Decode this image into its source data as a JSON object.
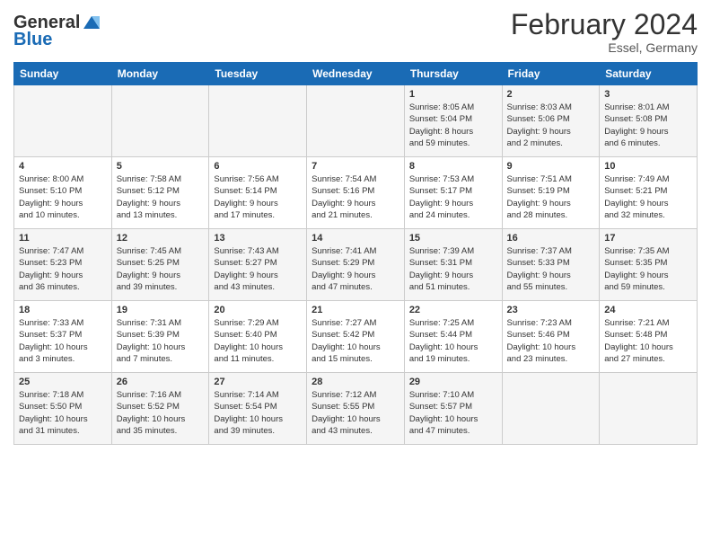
{
  "header": {
    "logo": {
      "general": "General",
      "blue": "Blue"
    },
    "title": "February 2024",
    "location": "Essel, Germany"
  },
  "days_of_week": [
    "Sunday",
    "Monday",
    "Tuesday",
    "Wednesday",
    "Thursday",
    "Friday",
    "Saturday"
  ],
  "weeks": [
    [
      {
        "day": "",
        "info": ""
      },
      {
        "day": "",
        "info": ""
      },
      {
        "day": "",
        "info": ""
      },
      {
        "day": "",
        "info": ""
      },
      {
        "day": "1",
        "info": "Sunrise: 8:05 AM\nSunset: 5:04 PM\nDaylight: 8 hours\nand 59 minutes."
      },
      {
        "day": "2",
        "info": "Sunrise: 8:03 AM\nSunset: 5:06 PM\nDaylight: 9 hours\nand 2 minutes."
      },
      {
        "day": "3",
        "info": "Sunrise: 8:01 AM\nSunset: 5:08 PM\nDaylight: 9 hours\nand 6 minutes."
      }
    ],
    [
      {
        "day": "4",
        "info": "Sunrise: 8:00 AM\nSunset: 5:10 PM\nDaylight: 9 hours\nand 10 minutes."
      },
      {
        "day": "5",
        "info": "Sunrise: 7:58 AM\nSunset: 5:12 PM\nDaylight: 9 hours\nand 13 minutes."
      },
      {
        "day": "6",
        "info": "Sunrise: 7:56 AM\nSunset: 5:14 PM\nDaylight: 9 hours\nand 17 minutes."
      },
      {
        "day": "7",
        "info": "Sunrise: 7:54 AM\nSunset: 5:16 PM\nDaylight: 9 hours\nand 21 minutes."
      },
      {
        "day": "8",
        "info": "Sunrise: 7:53 AM\nSunset: 5:17 PM\nDaylight: 9 hours\nand 24 minutes."
      },
      {
        "day": "9",
        "info": "Sunrise: 7:51 AM\nSunset: 5:19 PM\nDaylight: 9 hours\nand 28 minutes."
      },
      {
        "day": "10",
        "info": "Sunrise: 7:49 AM\nSunset: 5:21 PM\nDaylight: 9 hours\nand 32 minutes."
      }
    ],
    [
      {
        "day": "11",
        "info": "Sunrise: 7:47 AM\nSunset: 5:23 PM\nDaylight: 9 hours\nand 36 minutes."
      },
      {
        "day": "12",
        "info": "Sunrise: 7:45 AM\nSunset: 5:25 PM\nDaylight: 9 hours\nand 39 minutes."
      },
      {
        "day": "13",
        "info": "Sunrise: 7:43 AM\nSunset: 5:27 PM\nDaylight: 9 hours\nand 43 minutes."
      },
      {
        "day": "14",
        "info": "Sunrise: 7:41 AM\nSunset: 5:29 PM\nDaylight: 9 hours\nand 47 minutes."
      },
      {
        "day": "15",
        "info": "Sunrise: 7:39 AM\nSunset: 5:31 PM\nDaylight: 9 hours\nand 51 minutes."
      },
      {
        "day": "16",
        "info": "Sunrise: 7:37 AM\nSunset: 5:33 PM\nDaylight: 9 hours\nand 55 minutes."
      },
      {
        "day": "17",
        "info": "Sunrise: 7:35 AM\nSunset: 5:35 PM\nDaylight: 9 hours\nand 59 minutes."
      }
    ],
    [
      {
        "day": "18",
        "info": "Sunrise: 7:33 AM\nSunset: 5:37 PM\nDaylight: 10 hours\nand 3 minutes."
      },
      {
        "day": "19",
        "info": "Sunrise: 7:31 AM\nSunset: 5:39 PM\nDaylight: 10 hours\nand 7 minutes."
      },
      {
        "day": "20",
        "info": "Sunrise: 7:29 AM\nSunset: 5:40 PM\nDaylight: 10 hours\nand 11 minutes."
      },
      {
        "day": "21",
        "info": "Sunrise: 7:27 AM\nSunset: 5:42 PM\nDaylight: 10 hours\nand 15 minutes."
      },
      {
        "day": "22",
        "info": "Sunrise: 7:25 AM\nSunset: 5:44 PM\nDaylight: 10 hours\nand 19 minutes."
      },
      {
        "day": "23",
        "info": "Sunrise: 7:23 AM\nSunset: 5:46 PM\nDaylight: 10 hours\nand 23 minutes."
      },
      {
        "day": "24",
        "info": "Sunrise: 7:21 AM\nSunset: 5:48 PM\nDaylight: 10 hours\nand 27 minutes."
      }
    ],
    [
      {
        "day": "25",
        "info": "Sunrise: 7:18 AM\nSunset: 5:50 PM\nDaylight: 10 hours\nand 31 minutes."
      },
      {
        "day": "26",
        "info": "Sunrise: 7:16 AM\nSunset: 5:52 PM\nDaylight: 10 hours\nand 35 minutes."
      },
      {
        "day": "27",
        "info": "Sunrise: 7:14 AM\nSunset: 5:54 PM\nDaylight: 10 hours\nand 39 minutes."
      },
      {
        "day": "28",
        "info": "Sunrise: 7:12 AM\nSunset: 5:55 PM\nDaylight: 10 hours\nand 43 minutes."
      },
      {
        "day": "29",
        "info": "Sunrise: 7:10 AM\nSunset: 5:57 PM\nDaylight: 10 hours\nand 47 minutes."
      },
      {
        "day": "",
        "info": ""
      },
      {
        "day": "",
        "info": ""
      }
    ]
  ]
}
